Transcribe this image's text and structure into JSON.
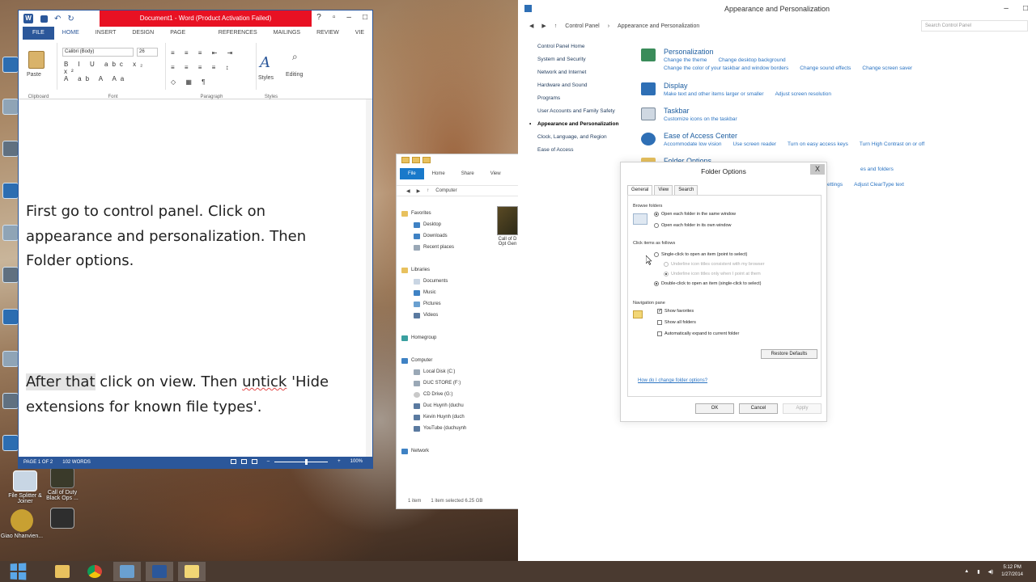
{
  "word": {
    "title": "Document1 - Word (Product Activation Failed)",
    "tabs": [
      "FILE",
      "HOME",
      "INSERT",
      "DESIGN",
      "PAGE LAYOUT",
      "REFERENCES",
      "MAILINGS",
      "REVIEW",
      "VIE"
    ],
    "ribbon": {
      "paste": "Paste",
      "font_name": "Calibri (Body)",
      "font_size": "26",
      "styles": "Styles",
      "editing": "Editing",
      "group_clipboard": "Clipboard",
      "group_font": "Font",
      "group_paragraph": "Paragraph",
      "group_styles": "Styles"
    },
    "doc": {
      "para1_line1": "First go to control panel. Click on",
      "para1_line2": "appearance and personalization. Then",
      "para1_line3": "Folder options.",
      "para2_hl": "After that",
      "para2_a": " click on view. Then ",
      "para2_squig": "untick",
      "para2_b": " 'Hide",
      "para2_line2": "extensions for known file types'."
    },
    "status": {
      "page": "PAGE 1 OF 2",
      "words": "102 WORDS",
      "zoom": "100%"
    }
  },
  "explorer": {
    "tabs": [
      "File",
      "Home",
      "Share",
      "View"
    ],
    "address": "Computer",
    "nav": {
      "favorites": "Favorites",
      "desktop": "Desktop",
      "downloads": "Downloads",
      "recent": "Recent places",
      "libraries": "Libraries",
      "documents": "Documents",
      "music": "Music",
      "pictures": "Pictures",
      "videos": "Videos",
      "homegroup": "Homegroup",
      "computer": "Computer",
      "local_disk": "Local Disk (C:)",
      "duc_store": "DUC STORE (F:)",
      "cd_drive": "CD Drive (G:)",
      "duc_huynh": "Duc Huynh (duchu",
      "kevin_huynh": "Kevin Huynh (duch",
      "youtube": "YouTube (duchuynh",
      "network": "Network"
    },
    "file_label": "Call of D Opt Gen",
    "status_items": "1 item",
    "status_selected": "1 item selected  6.25 GB"
  },
  "control_panel": {
    "title": "Appearance and Personalization",
    "breadcrumb": [
      "Control Panel",
      "Appearance and Personalization"
    ],
    "search_placeholder": "Search Control Panel",
    "left_links": {
      "home": "Control Panel Home",
      "system": "System and Security",
      "network": "Network and Internet",
      "hardware": "Hardware and Sound",
      "programs": "Programs",
      "users": "User Accounts and Family Safety",
      "appearance": "Appearance and Personalization",
      "clock": "Clock, Language, and Region",
      "ease": "Ease of Access"
    },
    "categories": {
      "personalization": {
        "title": "Personalization",
        "links": [
          "Change the theme",
          "Change desktop background",
          "Change the color of your taskbar and window borders",
          "Change sound effects",
          "Change screen saver"
        ]
      },
      "display": {
        "title": "Display",
        "links": [
          "Make text and other items larger or smaller",
          "Adjust screen resolution"
        ]
      },
      "taskbar": {
        "title": "Taskbar",
        "links": [
          "Customize icons on the taskbar"
        ]
      },
      "ease": {
        "title": "Ease of Access Center",
        "links": [
          "Accommodate low vision",
          "Use screen reader",
          "Turn on easy access keys",
          "Turn High Contrast on or off"
        ]
      },
      "folder": {
        "title": "Folder Options",
        "link_partial": "es and folders"
      },
      "fonts": {
        "link_partial": "ettings",
        "link2": "Adjust ClearType text"
      }
    }
  },
  "folder_options": {
    "title": "Folder Options",
    "close": "X",
    "tabs": [
      "General",
      "View",
      "Search"
    ],
    "browse_folders": "Browse folders",
    "browse_same": "Open each folder in the same window",
    "browse_own": "Open each folder in its own window",
    "click_items": "Click items as follows",
    "single_click": "Single-click to open an item (point to select)",
    "underline_browser": "Underline icon titles consistent with my browser",
    "underline_point": "Underline icon titles only when I point at them",
    "double_click": "Double-click to open an item (single-click to select)",
    "nav_pane": "Navigation pane",
    "show_favorites": "Show favorites",
    "show_all": "Show all folders",
    "auto_expand": "Automatically expand to current folder",
    "restore": "Restore Defaults",
    "help_link": "How do I change folder options?",
    "ok": "OK",
    "cancel": "Cancel",
    "apply": "Apply"
  },
  "desktop": {
    "shortcut1": "File Splitter & Joiner",
    "shortcut2": "Call of Duty Black Ops ...",
    "shortcut3": "Giao Nhanvien..."
  },
  "taskbar": {
    "time": "5:12 PM",
    "date": "1/27/2014"
  },
  "colors": {
    "word_blue": "#2b579a",
    "activation_red": "#e81123",
    "cp_link": "#2a73c2"
  }
}
